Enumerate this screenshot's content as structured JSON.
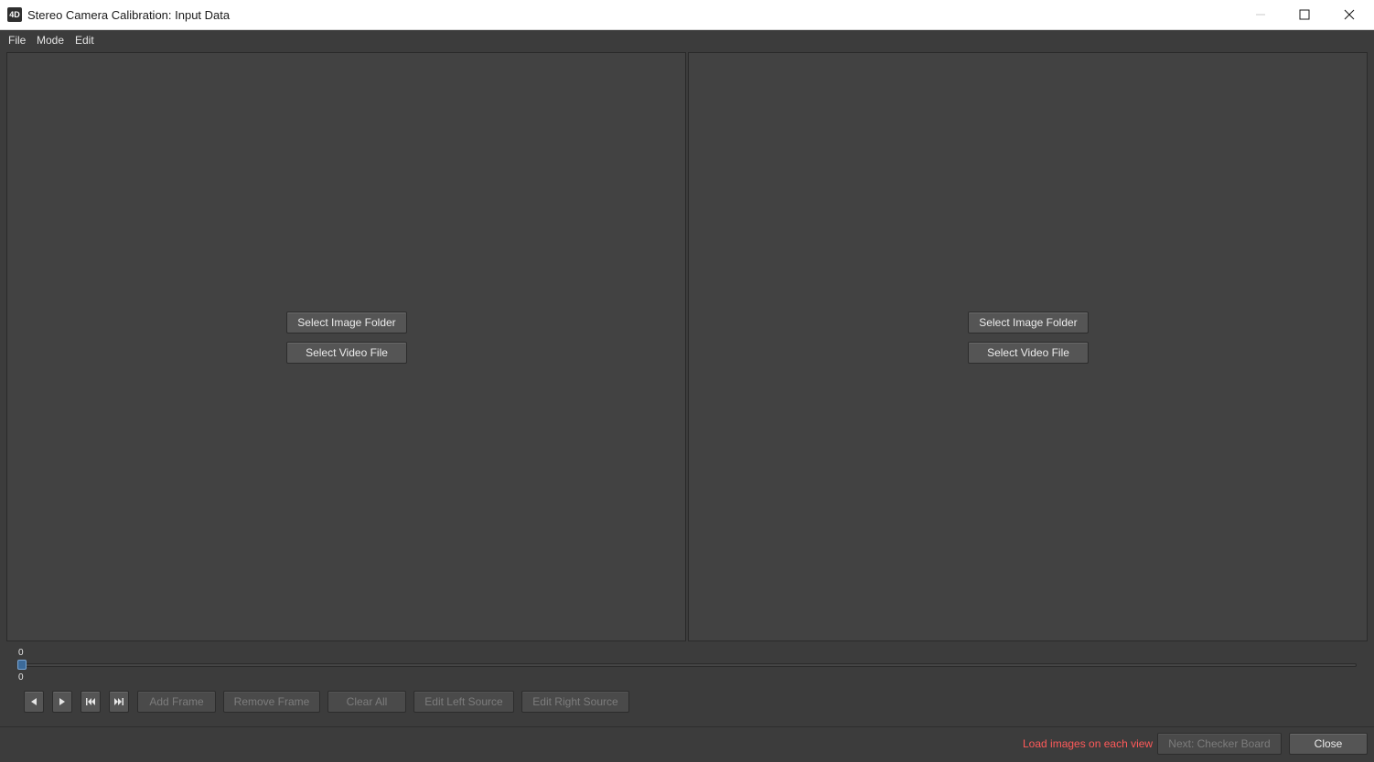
{
  "window": {
    "icon_label": "4D",
    "title": "Stereo Camera Calibration: Input Data"
  },
  "menu": {
    "items": [
      "File",
      "Mode",
      "Edit"
    ]
  },
  "views": {
    "left": {
      "select_image_folder": "Select Image Folder",
      "select_video_file": "Select Video File"
    },
    "right": {
      "select_image_folder": "Select Image Folder",
      "select_video_file": "Select Video File"
    }
  },
  "timeline": {
    "top_value": "0",
    "bottom_value": "0",
    "position_fraction": 0
  },
  "toolbar": {
    "add_frame": "Add Frame",
    "remove_frame": "Remove Frame",
    "clear_all": "Clear All",
    "edit_left_source": "Edit Left Source",
    "edit_right_source": "Edit Right Source",
    "icons": [
      "step-back-icon",
      "play-icon",
      "skip-to-start-icon",
      "skip-to-end-icon"
    ]
  },
  "footer": {
    "status": "Load images on each view",
    "next_button": "Next: Checker Board",
    "close_button": "Close"
  },
  "colors": {
    "status_text": "#ff5a5a",
    "background": "#3c3c3c",
    "view_background": "#424242",
    "slider_handle": "#3c6a99"
  }
}
